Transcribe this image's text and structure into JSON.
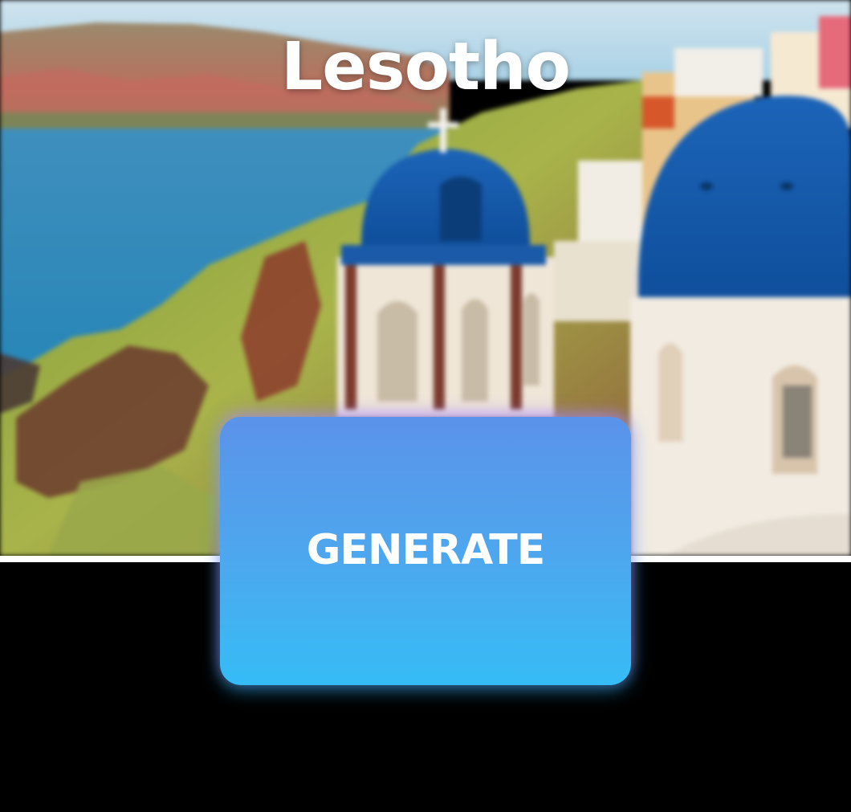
{
  "header": {
    "title": "Lesotho"
  },
  "background": {
    "image_subject": "coastal-village-blue-domes"
  },
  "actions": {
    "generate_label": "GENERATE"
  },
  "colors": {
    "page_background": "#000000",
    "divider": "#ffffff",
    "button_gradient_top": "#5b93ea",
    "button_gradient_bottom": "#36bcf6",
    "button_glow": "#be78ff",
    "title_text": "#ffffff"
  }
}
